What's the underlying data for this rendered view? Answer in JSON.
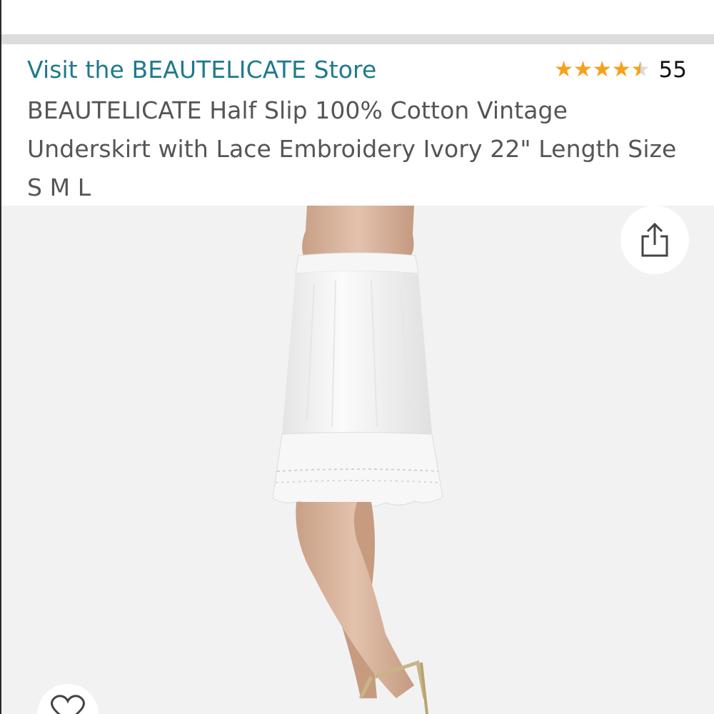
{
  "product": {
    "store_link": "Visit the BEAUTELICATE Store",
    "rating": {
      "value": 4.5,
      "max": 5,
      "review_count": "55"
    },
    "title": "BEAUTELICATE Half Slip 100% Cotton Vintage Underskirt with Lace Embroidery Ivory 22\" Length Size S M L"
  },
  "icons": {
    "share": "share-icon",
    "favorite": "heart-icon",
    "rating": "star-icon"
  },
  "colors": {
    "link": "#1f7a8c",
    "star": "#f7a11a",
    "image_background": "#f2f2f2"
  }
}
